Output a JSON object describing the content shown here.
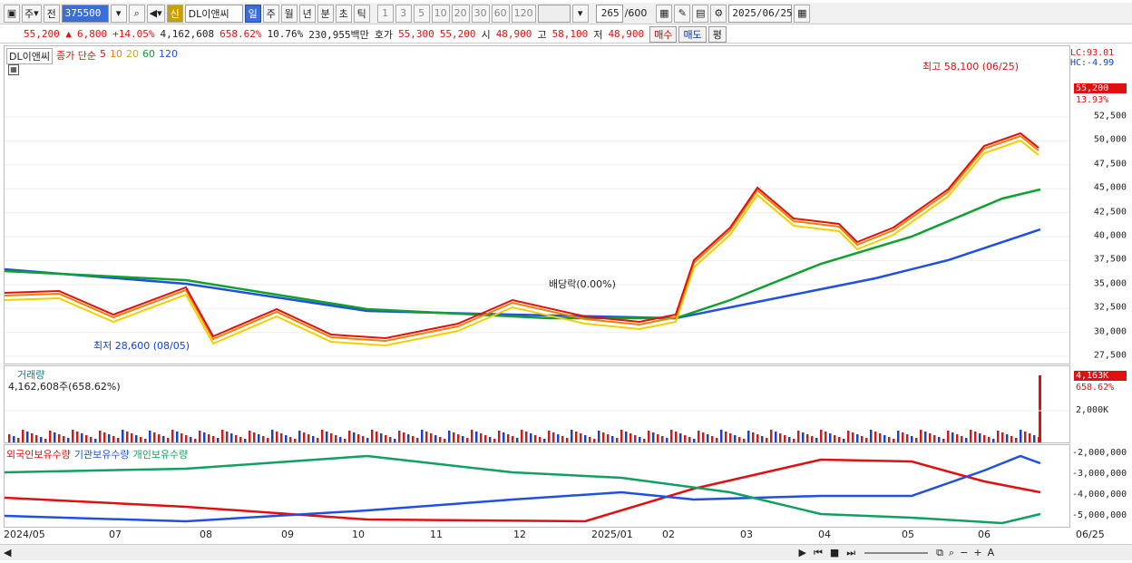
{
  "toolbar": {
    "type": "주",
    "period_mode": "전",
    "code": "375500",
    "flag": "신",
    "name": "DL이앤씨",
    "periods": [
      "일",
      "주",
      "월",
      "년",
      "분",
      "초",
      "틱"
    ],
    "intervals": [
      "1",
      "3",
      "5",
      "10",
      "20",
      "30",
      "60",
      "120"
    ],
    "count": "265",
    "count_max": "/600",
    "date": "2025/06/25"
  },
  "quote": {
    "price": "55,200",
    "change": "6,800",
    "change_pct": "+14.05%",
    "volume": "4,162,608",
    "vol_ratio": "658.62%",
    "turnover": "10.76%",
    "amount": "230,955백만",
    "ask_label": "호가",
    "ask1": "55,300",
    "ask2": "55,200",
    "open_label": "시",
    "open": "48,900",
    "high_label": "고",
    "high": "58,100",
    "low_label": "저",
    "low": "48,900",
    "buy": "매수",
    "sell": "매도",
    "avg": "평"
  },
  "legend": {
    "name": "DL이앤씨",
    "ma_label": "종가 단순",
    "ma": [
      "5",
      "10",
      "20",
      "60",
      "120"
    ],
    "ma_colors": [
      "#e01010",
      "#f08000",
      "#f0d000",
      "#10a030",
      "#2050e0"
    ]
  },
  "annotations": {
    "high": "최고 58,100 (06/25)",
    "low": "최저 28,600 (08/05)",
    "dividend": "배당락(0.00%)"
  },
  "price_axis": {
    "lc": "LC:93.01",
    "hc": "HC:-4.99",
    "current": "55,200",
    "current_pct": "13.93%",
    "ticks": [
      "52,500",
      "50,000",
      "47,500",
      "45,000",
      "42,500",
      "40,000",
      "37,500",
      "35,000",
      "32,500",
      "30,000",
      "27,500"
    ]
  },
  "volume": {
    "title": "거래량",
    "value": "4,162,608주(658.62%)",
    "axis_current": "4,163K",
    "axis_pct": "658.62%",
    "tick": "2,000K"
  },
  "holders": {
    "series": [
      "외국인보유수량",
      "기관보유수량",
      "개인보유수량"
    ],
    "colors": [
      "#e01010",
      "#2050e0",
      "#10a060"
    ],
    "ticks": [
      "-2,000,000",
      "-3,000,000",
      "-4,000,000",
      "-5,000,000"
    ]
  },
  "xaxis": {
    "labels": [
      "2024/05",
      "07",
      "08",
      "09",
      "10",
      "11",
      "12",
      "2025/01",
      "02",
      "03",
      "04",
      "05",
      "06"
    ],
    "right": "06/25"
  }
}
